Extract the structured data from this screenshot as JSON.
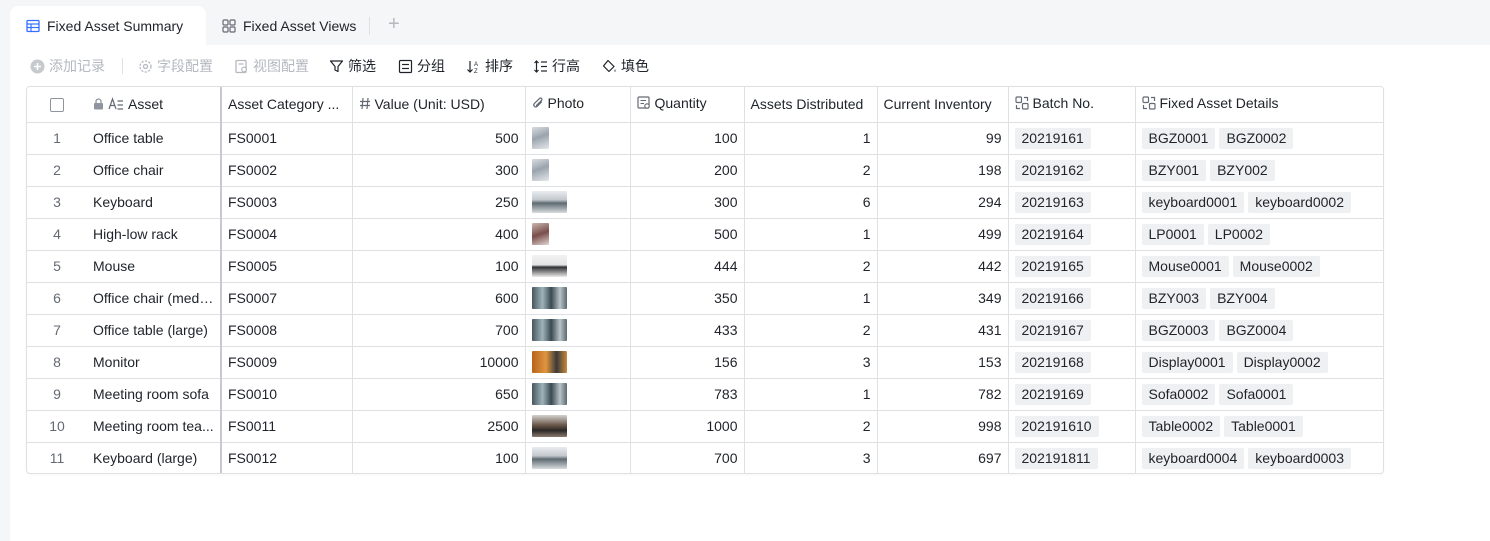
{
  "tabs": {
    "active": "Fixed Asset Summary",
    "views": "Fixed Asset Views"
  },
  "toolbar": {
    "add_record": "添加记录",
    "field_config": "字段配置",
    "view_config": "视图配置",
    "filter": "筛选",
    "group": "分组",
    "sort": "排序",
    "row_height": "行高",
    "fill_color": "填色"
  },
  "columns": {
    "asset": "Asset",
    "category": "Asset Category ...",
    "value": "Value (Unit: USD)",
    "photo": "Photo",
    "quantity": "Quantity",
    "distributed": "Assets Distributed",
    "inventory": "Current Inventory",
    "batch": "Batch No.",
    "details": "Fixed Asset Details"
  },
  "rows": [
    {
      "n": "1",
      "asset": "Office table",
      "category": "FS0001",
      "value": "500",
      "photo": "sm-gray",
      "quantity": "100",
      "distributed": "1",
      "inventory": "99",
      "batch": "20219161",
      "details": [
        "BGZ0001",
        "BGZ0002"
      ]
    },
    {
      "n": "2",
      "asset": "Office chair",
      "category": "FS0002",
      "value": "300",
      "photo": "sm-gray",
      "quantity": "200",
      "distributed": "2",
      "inventory": "198",
      "batch": "20219162",
      "details": [
        "BZY001",
        "BZY002"
      ]
    },
    {
      "n": "3",
      "asset": "Keyboard",
      "category": "FS0003",
      "value": "250",
      "photo": "lg-office",
      "quantity": "300",
      "distributed": "6",
      "inventory": "294",
      "batch": "20219163",
      "details": [
        "keyboard0001",
        "keyboard0002"
      ]
    },
    {
      "n": "4",
      "asset": "High-low rack",
      "category": "FS0004",
      "value": "400",
      "photo": "sm-rack",
      "quantity": "500",
      "distributed": "1",
      "inventory": "499",
      "batch": "20219164",
      "details": [
        "LP0001",
        "LP0002"
      ]
    },
    {
      "n": "5",
      "asset": "Mouse",
      "category": "FS0005",
      "value": "100",
      "photo": "lg-mouse",
      "quantity": "444",
      "distributed": "2",
      "inventory": "442",
      "batch": "20219165",
      "details": [
        "Mouse0001",
        "Mouse0002"
      ]
    },
    {
      "n": "6",
      "asset": "Office chair (medi...",
      "category": "FS0007",
      "value": "600",
      "photo": "lg-room",
      "quantity": "350",
      "distributed": "1",
      "inventory": "349",
      "batch": "20219166",
      "details": [
        "BZY003",
        "BZY004"
      ]
    },
    {
      "n": "7",
      "asset": "Office table (large)",
      "category": "FS0008",
      "value": "700",
      "photo": "lg-room",
      "quantity": "433",
      "distributed": "2",
      "inventory": "431",
      "batch": "20219167",
      "details": [
        "BGZ0003",
        "BGZ0004"
      ]
    },
    {
      "n": "8",
      "asset": "Monitor",
      "category": "FS0009",
      "value": "10000",
      "photo": "lg-warm",
      "quantity": "156",
      "distributed": "3",
      "inventory": "153",
      "batch": "20219168",
      "details": [
        "Display0001",
        "Display0002"
      ]
    },
    {
      "n": "9",
      "asset": "Meeting room sofa",
      "category": "FS0010",
      "value": "650",
      "photo": "lg-room",
      "quantity": "783",
      "distributed": "1",
      "inventory": "782",
      "batch": "20219169",
      "details": [
        "Sofa0002",
        "Sofa0001"
      ]
    },
    {
      "n": "10",
      "asset": "Meeting room tea...",
      "category": "FS0011",
      "value": "2500",
      "photo": "lg-dark",
      "quantity": "1000",
      "distributed": "2",
      "inventory": "998",
      "batch": "202191610",
      "details": [
        "Table0002",
        "Table0001"
      ]
    },
    {
      "n": "11",
      "asset": "Keyboard (large)",
      "category": "FS0012",
      "value": "100",
      "photo": "lg-office",
      "quantity": "700",
      "distributed": "3",
      "inventory": "697",
      "batch": "202191811",
      "details": [
        "keyboard0004",
        "keyboard0003"
      ]
    }
  ]
}
